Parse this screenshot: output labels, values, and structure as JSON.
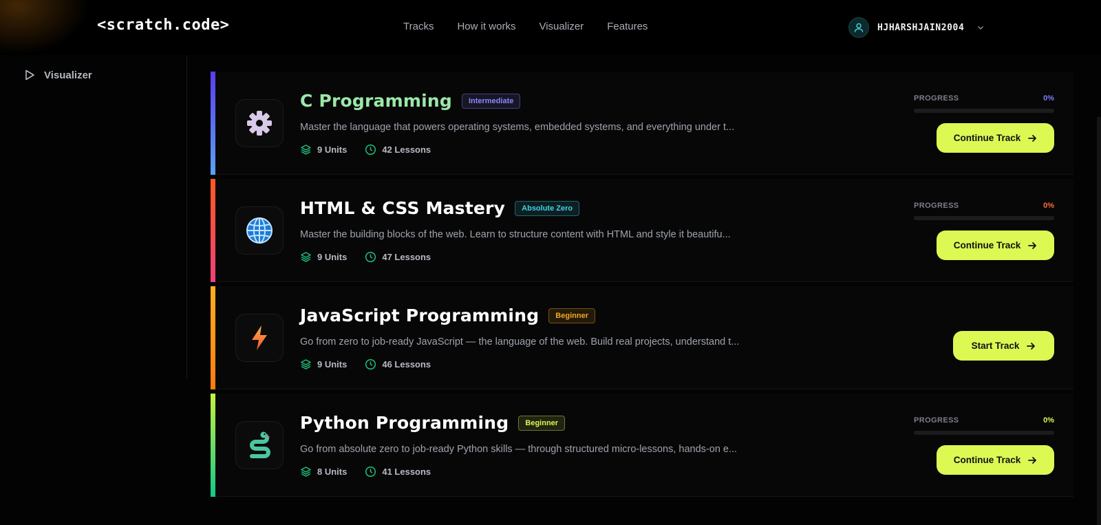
{
  "header": {
    "logo": "<scratch.code>",
    "nav": [
      "Tracks",
      "How it works",
      "Visualizer",
      "Features"
    ],
    "username": "HJHARSHJAIN2004"
  },
  "sidebar": {
    "items": [
      {
        "label": "Visualizer",
        "icon": "play-icon"
      }
    ]
  },
  "tracks": [
    {
      "title": "C Programming",
      "title_color": "#9be8a8",
      "badge": "Intermediate",
      "badge_color": "#8b86ff",
      "accent_from": "#5b3cf0",
      "accent_to": "#5aa3f5",
      "icon": "gear-icon",
      "description": "Master the language that powers operating systems, embedded systems, and everything under t...",
      "units": "9 Units",
      "lessons": "42 Lessons",
      "progress_label": "PROGRESS",
      "progress_value": "0%",
      "progress_color": "#7d7dff",
      "progress": 0,
      "button": "Continue Track"
    },
    {
      "title": "HTML & CSS Mastery",
      "title_color": "#ffffff",
      "badge": "Absolute Zero",
      "badge_color": "#3fd1e8",
      "accent_from": "#ff5a1f",
      "accent_to": "#f0407a",
      "icon": "globe-icon",
      "description": "Master the building blocks of the web. Learn to structure content with HTML and style it beautifu...",
      "units": "9 Units",
      "lessons": "47 Lessons",
      "progress_label": "PROGRESS",
      "progress_value": "0%",
      "progress_color": "#ff6a3a",
      "progress": 0,
      "button": "Continue Track"
    },
    {
      "title": "JavaScript Programming",
      "title_color": "#ffffff",
      "badge": "Beginner",
      "badge_color": "#f2a825",
      "accent_from": "#ffb01f",
      "accent_to": "#ff7a10",
      "icon": "lightning-icon",
      "description": "Go from zero to job-ready JavaScript — the language of the web. Build real projects, understand t...",
      "units": "9 Units",
      "lessons": "46 Lessons",
      "button": "Start Track"
    },
    {
      "title": "Python Programming",
      "title_color": "#ffffff",
      "badge": "Beginner",
      "badge_color": "#dcf853",
      "accent_from": "#c8f040",
      "accent_to": "#12c98a",
      "icon": "snake-icon",
      "description": "Go from absolute zero to job-ready Python skills — through structured micro-lessons, hands-on e...",
      "units": "8 Units",
      "lessons": "41 Lessons",
      "progress_label": "PROGRESS",
      "progress_value": "0%",
      "progress_color": "#dcf853",
      "progress": 0,
      "button": "Continue Track"
    }
  ]
}
